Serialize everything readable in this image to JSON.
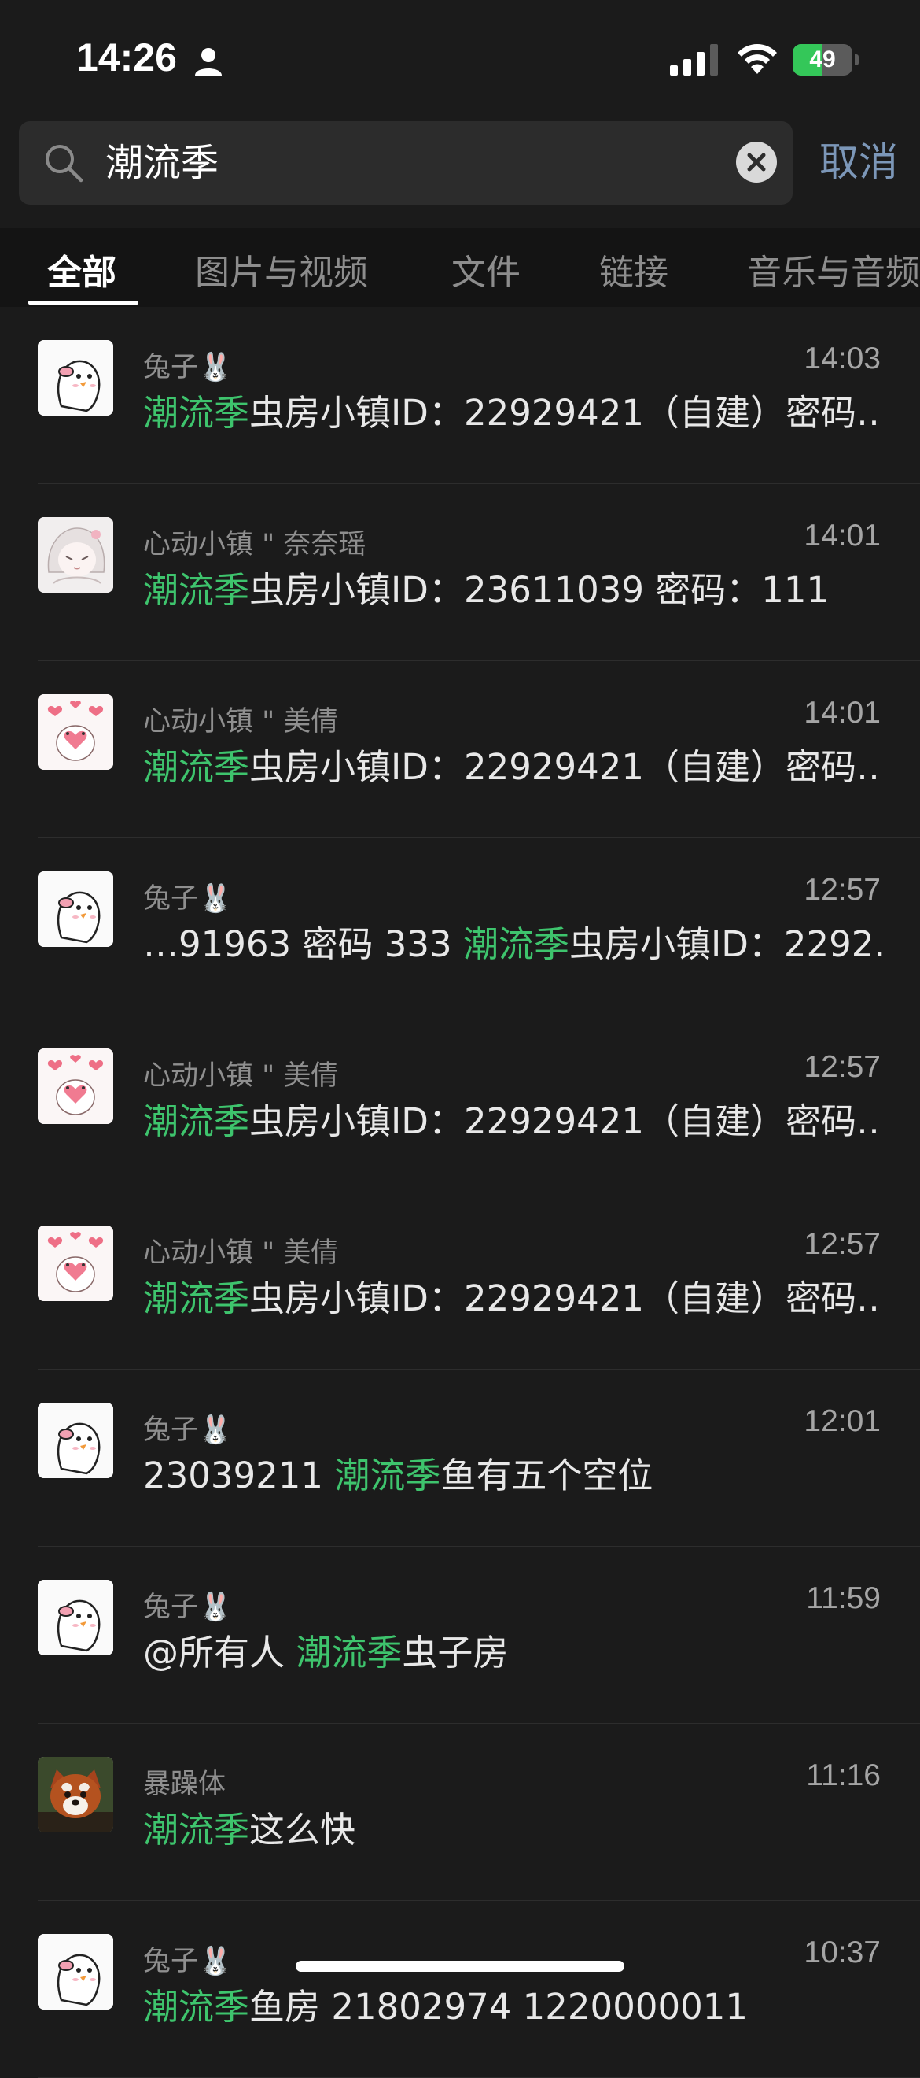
{
  "status_bar": {
    "time": "14:26",
    "battery": "49"
  },
  "search": {
    "query": "潮流季",
    "cancel_label": "取消"
  },
  "tabs": [
    {
      "label": "全部",
      "active": true
    },
    {
      "label": "图片与视频",
      "active": false
    },
    {
      "label": "文件",
      "active": false
    },
    {
      "label": "链接",
      "active": false
    },
    {
      "label": "音乐与音频",
      "active": false
    }
  ],
  "results": [
    {
      "sender": "兔子🐰",
      "time": "14:03",
      "avatar": "duck-sticker-avatar",
      "pre": "",
      "hl": "潮流季",
      "post": "虫房小镇ID：22929421（自建）密码…"
    },
    {
      "sender": "心动小镇 \" 奈奈瑶",
      "time": "14:01",
      "avatar": "anime-girl-avatar",
      "pre": "",
      "hl": "潮流季",
      "post": "虫房小镇ID：23611039 密码：111"
    },
    {
      "sender": "心动小镇 \" 美倩",
      "time": "14:01",
      "avatar": "hearts-bear-avatar",
      "pre": "",
      "hl": "潮流季",
      "post": "虫房小镇ID：22929421（自建）密码…"
    },
    {
      "sender": "兔子🐰",
      "time": "12:57",
      "avatar": "duck-sticker-avatar",
      "pre": "…91963 密码 333 ",
      "hl": "潮流季",
      "post": "虫房小镇ID：2292…"
    },
    {
      "sender": "心动小镇 \" 美倩",
      "time": "12:57",
      "avatar": "hearts-bear-avatar",
      "pre": "",
      "hl": "潮流季",
      "post": "虫房小镇ID：22929421（自建）密码…"
    },
    {
      "sender": "心动小镇 \" 美倩",
      "time": "12:57",
      "avatar": "hearts-bear-avatar",
      "pre": "",
      "hl": "潮流季",
      "post": "虫房小镇ID：22929421（自建）密码…"
    },
    {
      "sender": "兔子🐰",
      "time": "12:01",
      "avatar": "duck-sticker-avatar",
      "pre": "23039211 ",
      "hl": "潮流季",
      "post": "鱼有五个空位"
    },
    {
      "sender": "兔子🐰",
      "time": "11:59",
      "avatar": "duck-sticker-avatar",
      "pre": "@所有人 ",
      "hl": "潮流季",
      "post": "虫子房"
    },
    {
      "sender": "暴躁体",
      "time": "11:16",
      "avatar": "red-panda-avatar",
      "pre": "",
      "hl": "潮流季",
      "post": "这么快"
    },
    {
      "sender": "兔子🐰",
      "time": "10:37",
      "avatar": "duck-sticker-avatar",
      "pre": "",
      "hl": "潮流季",
      "post": "鱼房 21802974 1220000011"
    }
  ],
  "colors": {
    "highlight": "#3ec46d",
    "cancel": "#7c97b8",
    "background": "#1b1b1b"
  }
}
